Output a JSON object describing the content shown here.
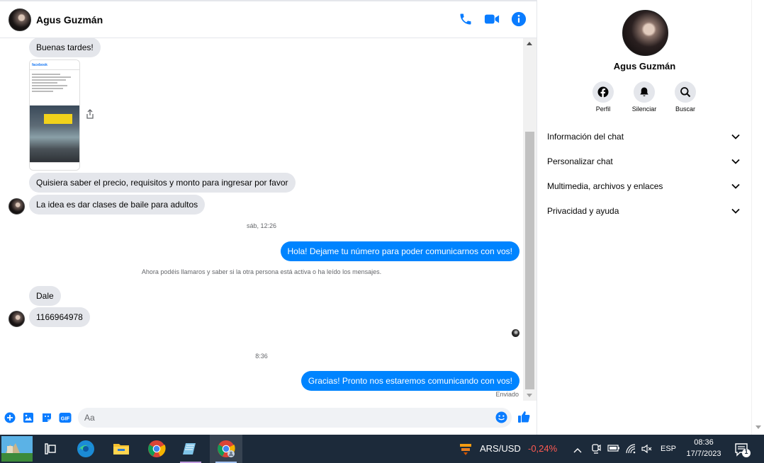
{
  "header": {
    "contact_name": "Agus Guzmán",
    "actions": [
      "phone-icon",
      "video-icon",
      "info-icon"
    ]
  },
  "messages": [
    {
      "dir": "in",
      "text": "Buenas tardes!"
    },
    {
      "dir": "in",
      "type": "image",
      "text": "facebook"
    },
    {
      "dir": "in",
      "text": "Quisiera saber el precio, requisitos y monto para ingresar por favor"
    },
    {
      "dir": "in",
      "text": "La idea es dar clases de baile para adultos"
    },
    {
      "type": "timestamp",
      "text": "sáb, 12:26"
    },
    {
      "dir": "out",
      "text": "Hola! Dejame tu número para poder comunicarnos con vos!"
    },
    {
      "type": "notice",
      "text": "Ahora podéis llamaros y saber si la otra persona está activa o ha leído los mensajes."
    },
    {
      "dir": "in",
      "text": "Dale"
    },
    {
      "dir": "in",
      "text": "1166964978"
    },
    {
      "type": "timestamp",
      "text": "8:36"
    },
    {
      "dir": "out",
      "text": "Gracias! Pronto nos estaremos comunicando con vos!"
    }
  ],
  "status": {
    "sent": "Enviado"
  },
  "composer": {
    "placeholder": "Aa",
    "buttons": [
      "plus-icon",
      "image-icon",
      "sticker-icon",
      "gif-icon",
      "emoji-icon",
      "like-icon"
    ],
    "gif_label": "GIF"
  },
  "profile": {
    "name": "Agus Guzmán",
    "actions": [
      {
        "icon": "facebook-icon",
        "label": "Perfil"
      },
      {
        "icon": "bell-icon",
        "label": "Silenciar"
      },
      {
        "icon": "search-icon",
        "label": "Buscar"
      }
    ],
    "sections": [
      {
        "label": "Información del chat"
      },
      {
        "label": "Personalizar chat"
      },
      {
        "label": "Multimedia, archivos y enlaces"
      },
      {
        "label": "Privacidad y ayuda"
      }
    ]
  },
  "taskbar": {
    "apps": [
      "start-icon",
      "task-view-icon",
      "edge-icon",
      "file-explorer-icon",
      "chrome-icon",
      "notepad-icon",
      "chrome-profile-icon"
    ],
    "ticker": {
      "pair": "ARS/USD",
      "change": "-0,24%"
    },
    "language": "ESP",
    "time": "08:36",
    "date": "17/7/2023",
    "notification_count": "1"
  },
  "colors": {
    "accent": "#0084ff",
    "bubble_in": "#e4e6eb",
    "ticker_down": "#ff5a52",
    "taskbar": "#1c2a3a"
  }
}
